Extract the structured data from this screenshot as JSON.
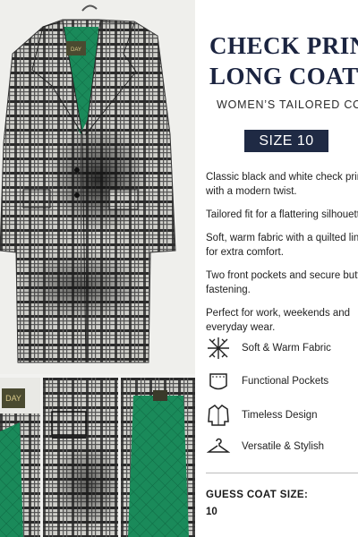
{
  "product": {
    "title_line1": "CHECK PRINT",
    "title_line2": "LONG COAT",
    "subtitle": "WOMEN’S TAILORED COAT",
    "size_badge": "SIZE 10",
    "label_text": "DAY"
  },
  "description": [
    "Classic black and white check print with a modern twist.",
    "Tailored fit for a flattering silhouette.",
    "Soft, warm fabric with a quilted lining for extra comfort.",
    "Two front pockets and secure button fastening.",
    "Perfect for work, weekends and everyday wear."
  ],
  "features": [
    {
      "icon": "fabric-weave-icon",
      "label": "Soft & Warm Fabric"
    },
    {
      "icon": "pocket-icon",
      "label": "Functional Pockets"
    },
    {
      "icon": "coat-icon",
      "label": "Timeless Design"
    },
    {
      "icon": "hanger-icon",
      "label": "Versatile & Stylish"
    }
  ],
  "question": {
    "prompt": "GUESS COAT SIZE:",
    "answer": "10"
  },
  "colors": {
    "navy": "#1f2a44",
    "lining_green": "#1a8a5a",
    "check_dark": "#2a2a2a",
    "check_light": "#d6d6d2"
  }
}
